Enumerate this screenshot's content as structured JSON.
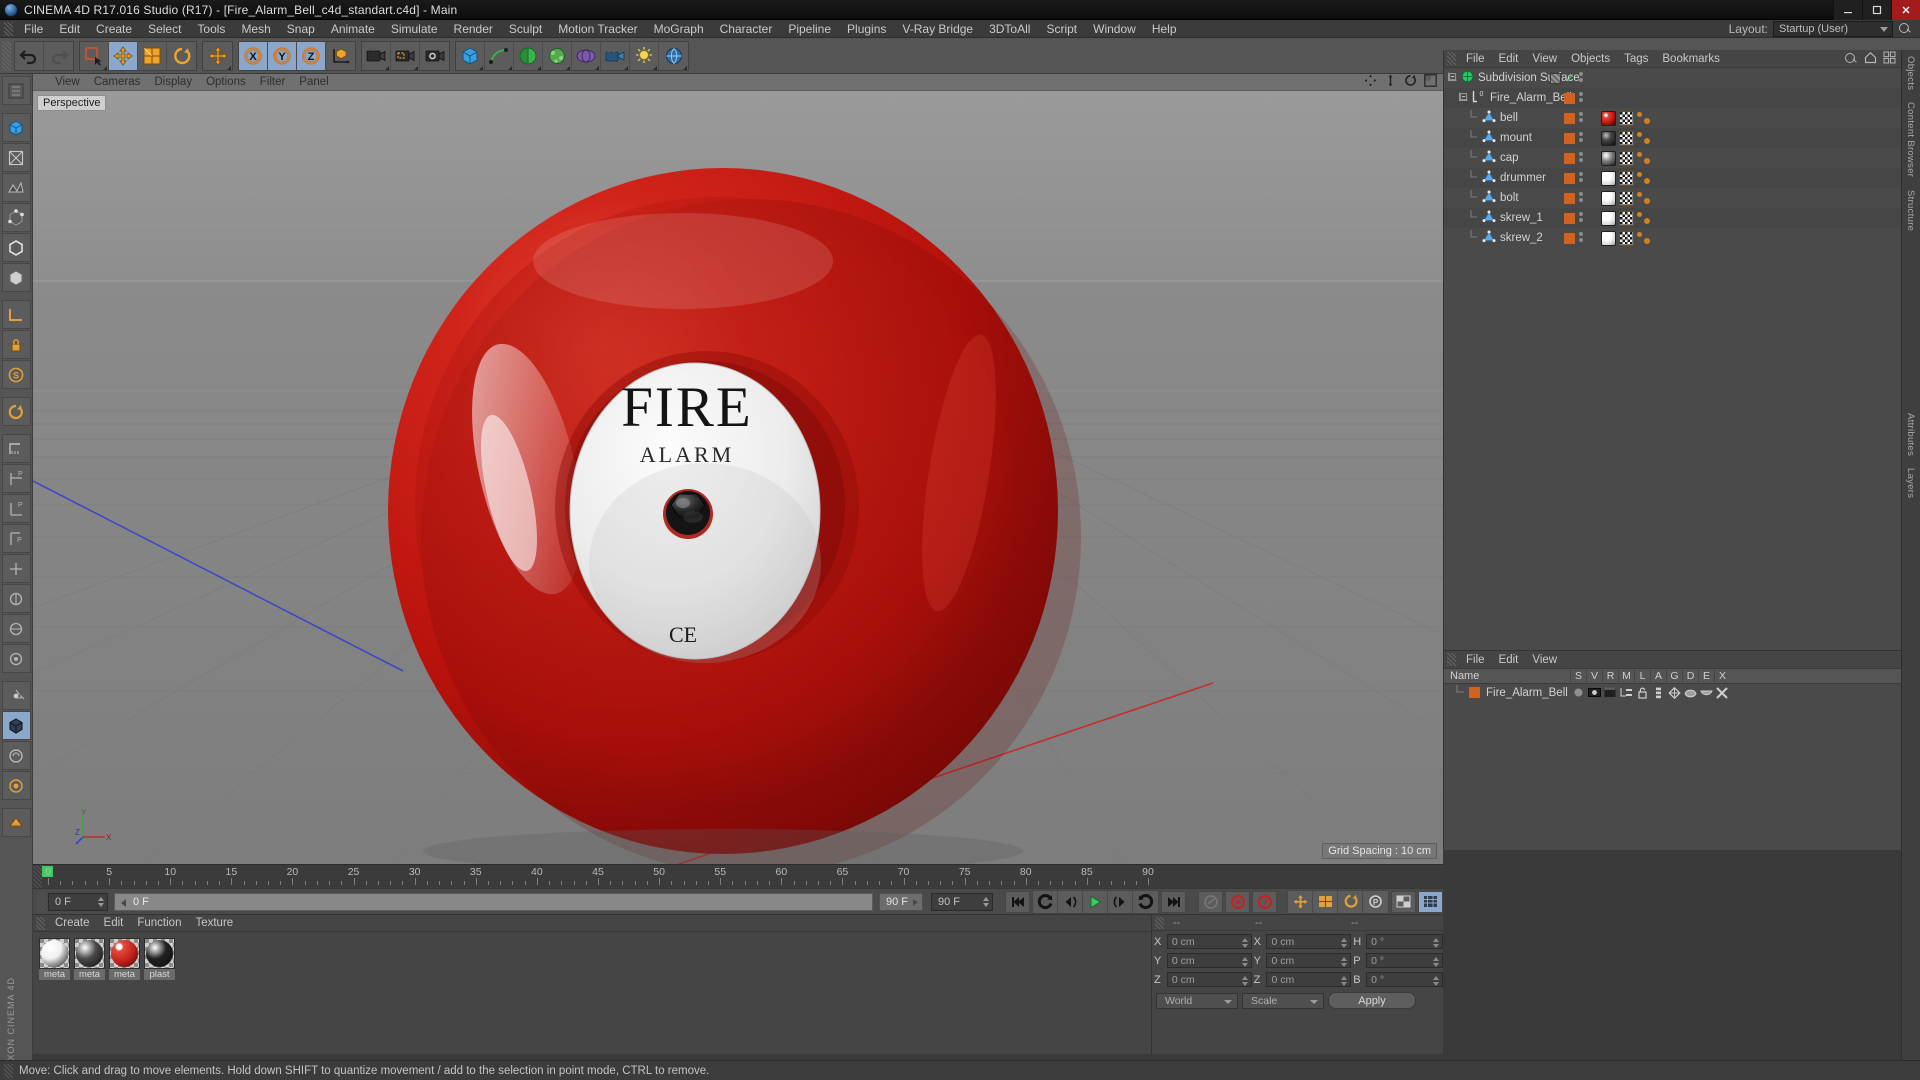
{
  "window": {
    "title": "CINEMA 4D R17.016 Studio (R17) - [Fire_Alarm_Bell_c4d_standart.c4d] - Main",
    "minimize": "–",
    "maximize": "❐",
    "close": "✕"
  },
  "menubar": {
    "items": [
      "File",
      "Edit",
      "Create",
      "Select",
      "Tools",
      "Mesh",
      "Snap",
      "Animate",
      "Simulate",
      "Render",
      "Sculpt",
      "Motion Tracker",
      "MoGraph",
      "Character",
      "Pipeline",
      "Plugins",
      "V-Ray Bridge",
      "3DToAll",
      "Script",
      "Window",
      "Help"
    ],
    "layout_label": "Layout:",
    "layout_value": "Startup (User)"
  },
  "viewport": {
    "menu": [
      "View",
      "Cameras",
      "Display",
      "Options",
      "Filter",
      "Panel"
    ],
    "label": "Perspective",
    "grid_spacing": "Grid Spacing : 10 cm",
    "object_text_main": "FIRE",
    "object_text_sub": "ALARM",
    "object_text_ce": "CE",
    "axis_x": "X",
    "axis_y": "Y",
    "axis_z": "Z"
  },
  "timeline": {
    "ticks": [
      0,
      5,
      10,
      15,
      20,
      25,
      30,
      35,
      40,
      45,
      50,
      55,
      60,
      65,
      70,
      75,
      80,
      85,
      90
    ],
    "current_frame_left": "0 F",
    "current_frame_right": "0 F"
  },
  "transport": {
    "start_field": "0 F",
    "preview_field": "0 F",
    "end_field_small": "90 F",
    "end_field": "90 F",
    "buttons": [
      "go-to-start",
      "rewind",
      "step-back",
      "play",
      "step-forward",
      "loop",
      "go-to-end",
      "record",
      "autokey",
      "keyframe-selection",
      "position-key",
      "scale-key",
      "rotation-key",
      "param-key",
      "point-level-anim",
      "timeline-mode"
    ]
  },
  "material_manager": {
    "menu": [
      "Create",
      "Edit",
      "Function",
      "Texture"
    ],
    "materials": [
      {
        "name": "meta",
        "color": "#f0f0f0"
      },
      {
        "name": "meta",
        "color": "#4a4a4a"
      },
      {
        "name": "meta",
        "color": "#c2211a"
      },
      {
        "name": "plast",
        "color": "#222222"
      }
    ]
  },
  "coordinates": {
    "header": [
      "--",
      "--",
      "--"
    ],
    "rows": [
      {
        "label1": "X",
        "value1": "0 cm",
        "label2": "X",
        "value2": "0 cm",
        "label3": "H",
        "value3": "0 °"
      },
      {
        "label1": "Y",
        "value1": "0 cm",
        "label2": "Y",
        "value2": "0 cm",
        "label3": "P",
        "value3": "0 °"
      },
      {
        "label1": "Z",
        "value1": "0 cm",
        "label2": "Z",
        "value2": "0 cm",
        "label3": "B",
        "value3": "0 °"
      }
    ],
    "system": "World",
    "mode": "Scale",
    "apply": "Apply"
  },
  "object_manager": {
    "menu": [
      "File",
      "Edit",
      "View",
      "Objects",
      "Tags",
      "Bookmarks"
    ],
    "rows": [
      {
        "name": "Subdivision Surface",
        "depth": 0,
        "icon": "subdivision-surface-icon",
        "color": null,
        "tags": [],
        "check": true
      },
      {
        "name": "Fire_Alarm_Bell",
        "depth": 1,
        "icon": "null-object-icon",
        "color": "#d1621f",
        "tags": []
      },
      {
        "name": "bell",
        "depth": 2,
        "icon": "polygon-object-icon",
        "color": "#d1621f",
        "tags": [
          "material-red",
          "uvw-tag",
          "checker-tag"
        ]
      },
      {
        "name": "mount",
        "depth": 2,
        "icon": "polygon-object-icon",
        "color": "#d1621f",
        "tags": [
          "material-black",
          "uvw-tag",
          "checker-tag"
        ]
      },
      {
        "name": "cap",
        "depth": 2,
        "icon": "polygon-object-icon",
        "color": "#d1621f",
        "tags": [
          "material-dark",
          "uvw-tag",
          "checker-tag"
        ]
      },
      {
        "name": "drummer",
        "depth": 2,
        "icon": "polygon-object-icon",
        "color": "#d1621f",
        "tags": [
          "material-white",
          "uvw-tag",
          "checker-tag"
        ]
      },
      {
        "name": "bolt",
        "depth": 2,
        "icon": "polygon-object-icon",
        "color": "#d1621f",
        "tags": [
          "material-white",
          "uvw-tag",
          "checker-tag"
        ]
      },
      {
        "name": "skrew_1",
        "depth": 2,
        "icon": "polygon-object-icon",
        "color": "#d1621f",
        "tags": [
          "material-white",
          "uvw-tag",
          "checker-tag"
        ]
      },
      {
        "name": "skrew_2",
        "depth": 2,
        "icon": "polygon-object-icon",
        "color": "#d1621f",
        "tags": [
          "material-white",
          "uvw-tag",
          "checker-tag"
        ]
      }
    ]
  },
  "layer_manager": {
    "menu": [
      "File",
      "Edit",
      "View"
    ],
    "columns": [
      "Name",
      "S",
      "V",
      "R",
      "M",
      "L",
      "A",
      "G",
      "D",
      "E",
      "X"
    ],
    "rows": [
      {
        "name": "Fire_Alarm_Bell",
        "color": "#d1621f"
      }
    ]
  },
  "right_tabs": [
    "Objects",
    "Content Browser",
    "Structure",
    "Attributes",
    "Layers"
  ],
  "statusbar": {
    "message": "Move: Click and drag to move elements. Hold down SHIFT to quantize movement / add to the selection in point mode, CTRL to remove."
  },
  "colors": {
    "accent_orange": "#d1621f",
    "bell_red": "#c0170f",
    "play_green": "#3dcc62",
    "selection_blue": "#8ba7cb"
  },
  "left_palette": [
    "live-selection-icon",
    "move-icon",
    "scale-icon",
    "rotate-icon",
    "workplane-icon",
    "lock-workplane-icon",
    "snap-icon",
    "model-mode-icon",
    "texture-mode-icon",
    "points-mode-icon",
    "edges-mode-icon",
    "polygons-mode-icon",
    "enable-axis-icon",
    "viewport-solo-icon",
    "deformer-icon",
    "render-region-icon"
  ]
}
